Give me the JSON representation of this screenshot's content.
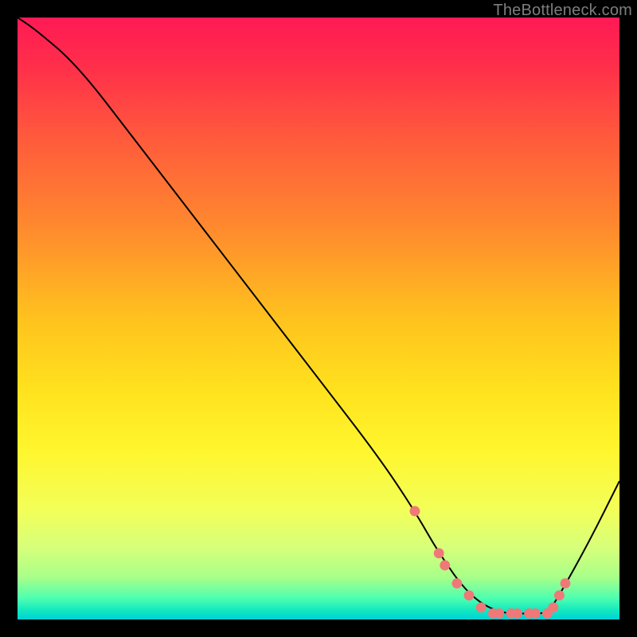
{
  "watermark": "TheBottleneck.com",
  "chart_data": {
    "type": "line",
    "title": "",
    "xlabel": "",
    "ylabel": "",
    "xlim": [
      0,
      100
    ],
    "ylim": [
      0,
      100
    ],
    "curve": {
      "name": "bottleneck-curve",
      "x": [
        0,
        3,
        10,
        20,
        30,
        40,
        50,
        60,
        66,
        70,
        75,
        80,
        85,
        88,
        90,
        95,
        100
      ],
      "y": [
        100,
        98,
        92,
        79,
        66,
        53,
        40,
        27,
        18,
        11,
        4,
        1,
        1,
        1,
        4,
        13,
        23
      ]
    },
    "highlight_points": {
      "name": "highlight-dots",
      "color": "#f07878",
      "x": [
        66,
        70,
        71,
        73,
        75,
        77,
        79,
        80,
        82,
        83,
        85,
        86,
        88,
        89,
        90,
        91
      ],
      "y": [
        18,
        11,
        9,
        6,
        4,
        2,
        1,
        1,
        1,
        1,
        1,
        1,
        1,
        2,
        4,
        6
      ]
    },
    "gradient_stops": [
      {
        "offset": 0.0,
        "color": "#ff1a55"
      },
      {
        "offset": 0.08,
        "color": "#ff2e4a"
      },
      {
        "offset": 0.2,
        "color": "#ff5a3c"
      },
      {
        "offset": 0.35,
        "color": "#ff8a2e"
      },
      {
        "offset": 0.5,
        "color": "#ffc21e"
      },
      {
        "offset": 0.62,
        "color": "#ffe21e"
      },
      {
        "offset": 0.72,
        "color": "#fff62e"
      },
      {
        "offset": 0.82,
        "color": "#f2ff5a"
      },
      {
        "offset": 0.88,
        "color": "#d7ff7a"
      },
      {
        "offset": 0.93,
        "color": "#a8ff8a"
      },
      {
        "offset": 0.965,
        "color": "#4dffb0"
      },
      {
        "offset": 0.985,
        "color": "#12e8c0"
      },
      {
        "offset": 1.0,
        "color": "#00d0d8"
      }
    ]
  }
}
